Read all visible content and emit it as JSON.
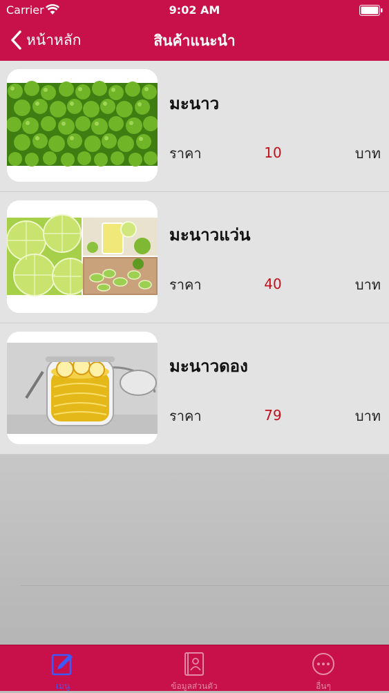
{
  "status_bar": {
    "carrier": "Carrier",
    "time": "9:02 AM"
  },
  "nav": {
    "back_label": "หน้าหลัก",
    "title": "สินค้าแนะนำ"
  },
  "products": [
    {
      "name": "มะนาว",
      "price_label": "ราคา",
      "price": "10",
      "currency": "บาท",
      "image": "limes-pile"
    },
    {
      "name": "มะนาวแว่น",
      "price_label": "ราคา",
      "price": "40",
      "currency": "บาท",
      "image": "lime-slices-collage"
    },
    {
      "name": "มะนาวดอง",
      "price_label": "ราคา",
      "price": "79",
      "currency": "บาท",
      "image": "pickled-lime-jar"
    }
  ],
  "tabs": [
    {
      "label": "เมนู",
      "icon": "compose-icon",
      "active": true
    },
    {
      "label": "ข้อมูลส่วนตัว",
      "icon": "contact-card-icon",
      "active": false
    },
    {
      "label": "อื่นๆ",
      "icon": "more-icon",
      "active": false
    }
  ],
  "colors": {
    "brand": "#c8104a",
    "price": "#c0101a",
    "tab_active": "#3b5bff",
    "tab_inactive": "#e58aa8"
  }
}
